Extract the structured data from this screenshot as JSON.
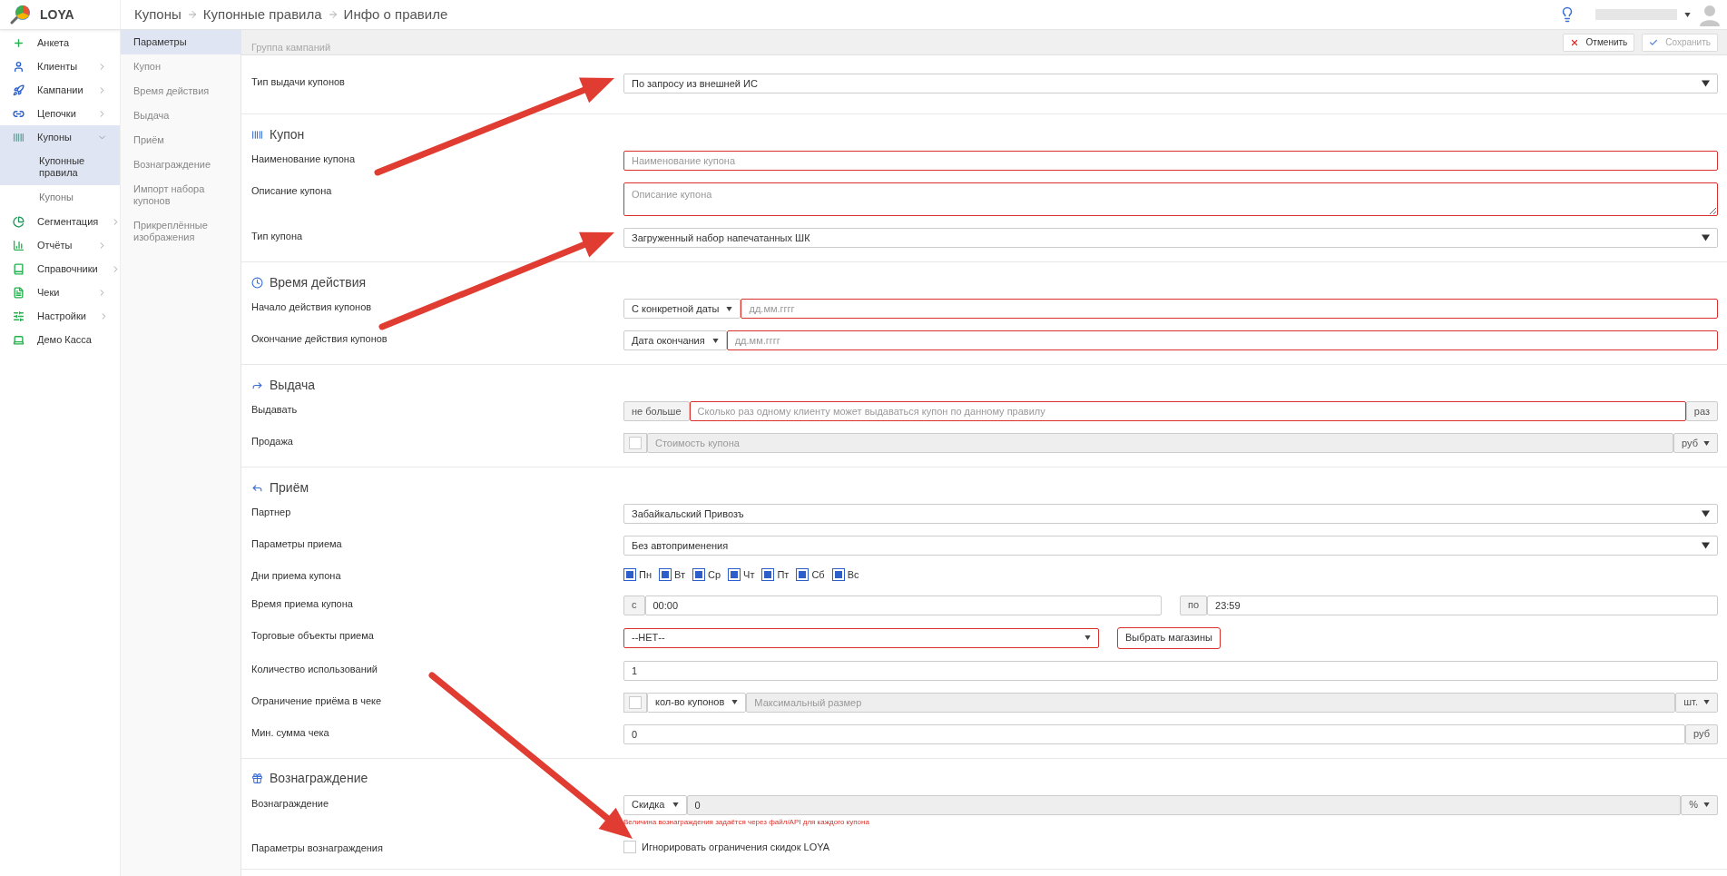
{
  "brand": {
    "name": "LOYA"
  },
  "breadcrumbs": [
    "Купоны",
    "Купонные правила",
    "Инфо о правиле"
  ],
  "sidebar": {
    "items": [
      {
        "label": "Анкета",
        "kind": "link",
        "selected": false
      },
      {
        "label": "Клиенты",
        "kind": "group",
        "expanded": false,
        "selected": false
      },
      {
        "label": "Кампании",
        "kind": "group",
        "expanded": false,
        "selected": false
      },
      {
        "label": "Цепочки",
        "kind": "group",
        "expanded": false,
        "selected": false
      },
      {
        "label": "Купоны",
        "kind": "group",
        "expanded": true,
        "selected": true,
        "children": [
          {
            "label": "Купонные правила",
            "selected": true
          },
          {
            "label": "Купоны",
            "selected": false
          }
        ]
      },
      {
        "label": "Сегментация",
        "kind": "group",
        "expanded": false,
        "selected": false
      },
      {
        "label": "Отчёты",
        "kind": "group",
        "expanded": false,
        "selected": false
      },
      {
        "label": "Справочники",
        "kind": "group",
        "expanded": false,
        "selected": false
      },
      {
        "label": "Чеки",
        "kind": "group",
        "expanded": false,
        "selected": false
      },
      {
        "label": "Настройки",
        "kind": "group",
        "expanded": false,
        "selected": false
      },
      {
        "label": "Демо Касса",
        "kind": "link",
        "selected": false
      }
    ]
  },
  "subnav": [
    {
      "label": "Параметры",
      "selected": true
    },
    {
      "label": "Купон",
      "selected": false
    },
    {
      "label": "Время действия",
      "selected": false
    },
    {
      "label": "Выдача",
      "selected": false
    },
    {
      "label": "Приём",
      "selected": false
    },
    {
      "label": "Вознаграждение",
      "selected": false
    },
    {
      "label": "Импорт набора купонов",
      "selected": false
    },
    {
      "label": "Прикреплённые изображения",
      "selected": false
    }
  ],
  "toolbar": {
    "hidden_label": "Группа кампаний",
    "buttons": [
      {
        "label": "Отменить",
        "kind": "cancel",
        "disabled": false
      },
      {
        "label": "Сохранить",
        "kind": "save",
        "disabled": true
      }
    ]
  },
  "sections": [
    {
      "rows": [
        {
          "label": "Тип выдачи купонов",
          "kind": "select",
          "value": "По запросу из внешней ИС"
        }
      ]
    },
    {
      "title": "Купон",
      "rows": [
        {
          "label": "Наименование купона",
          "kind": "addon",
          "placeholder": "Наименование купона",
          "invalid": true
        },
        {
          "label": "Описание купона",
          "kind": "textarea",
          "placeholder": "Описание купона",
          "invalid": true
        },
        {
          "label": "Тип купона",
          "kind": "select",
          "value": "Загруженный набор напечатанных ШК"
        }
      ]
    },
    {
      "title": "Время действия",
      "rows": [
        {
          "label": "Начало действия купонов",
          "kind": "date",
          "mode": "С конкретной даты",
          "placeholder": "дд.мм.гггг",
          "invalid": true
        },
        {
          "label": "Окончание действия купонов",
          "kind": "date",
          "mode": "Дата окончания",
          "placeholder": "дд.мм.гггг",
          "invalid": true
        }
      ]
    },
    {
      "title": "Выдача",
      "rows": [
        {
          "label": "Выдавать",
          "kind": "addon",
          "prefix": "не больше",
          "placeholder": "Сколько раз одному клиенту может выдаваться купон по данному правилу",
          "suffix": "раз",
          "invalid": true
        },
        {
          "label": "Продажа",
          "kind": "priced",
          "checked": false,
          "placeholder": "Стоимость купона",
          "unit": "руб"
        }
      ]
    },
    {
      "title": "Приём",
      "rows": [
        {
          "label": "Партнер",
          "kind": "select",
          "value": "Забайкальский Привозъ"
        },
        {
          "label": "Параметры приема",
          "kind": "select",
          "value": "Без автоприменения"
        },
        {
          "label": "Дни приема купона",
          "kind": "days",
          "days": [
            {
              "label": "Пн",
              "checked": true
            },
            {
              "label": "Вт",
              "checked": true
            },
            {
              "label": "Ср",
              "checked": true
            },
            {
              "label": "Чт",
              "checked": true
            },
            {
              "label": "Пт",
              "checked": true
            },
            {
              "label": "Сб",
              "checked": true
            },
            {
              "label": "Вс",
              "checked": true
            }
          ]
        },
        {
          "label": "Время приема купона",
          "kind": "time_range",
          "from_prefix": "с",
          "from": "00:00",
          "to_prefix": "по",
          "to": "23:59"
        },
        {
          "label": "Торговые объекты приема",
          "kind": "stores",
          "value": "--НЕТ--",
          "button": "Выбрать магазины",
          "invalid": true
        },
        {
          "label": "Количество использований",
          "kind": "addon",
          "value": "1",
          "invalid": false
        },
        {
          "label": "Ограничение приёма в чеке",
          "kind": "receipt_limit",
          "checked": false,
          "mode": "кол-во купонов",
          "placeholder": "Максимальный размер",
          "unit": "шт."
        },
        {
          "label": "Мин. сумма чека",
          "kind": "addon",
          "value": "0",
          "suffix": "руб",
          "invalid": false
        }
      ]
    },
    {
      "title": "Вознаграждение",
      "rows": [
        {
          "label": "Вознаграждение",
          "kind": "reward",
          "mode": "Скидка",
          "value": "0",
          "unit": "%",
          "hint": "Величина вознаграждения задаётся через файл/API для каждого купона"
        },
        {
          "label": "Параметры вознаграждения",
          "kind": "checkbox",
          "checked": false,
          "text": "Игнорировать ограничения скидок LOYA"
        }
      ]
    }
  ]
}
